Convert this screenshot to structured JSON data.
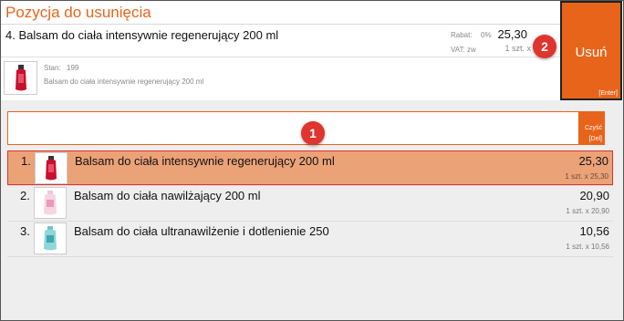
{
  "header": {
    "title": "Pozycja do usunięcia"
  },
  "selected": {
    "name": "4. Balsam do ciała intensywnie regenerujący 200 ml",
    "rabat_label": "Rabat:",
    "rabat_value": "0%",
    "vat_label": "VAT:",
    "vat_value": "zw",
    "price": "25,30",
    "qty": "1 szt. x",
    "stan_label": "Stan:",
    "stan_value": "199",
    "description": "Balsam do ciała intensywnie regenerujący 200 ml",
    "thumb_icon": "lotion-bottle-red-icon"
  },
  "remove_button": {
    "label": "Usuń",
    "shortcut": "[Enter]"
  },
  "search": {
    "value": "",
    "clear_label": "Czyść",
    "clear_shortcut": "[Del]"
  },
  "items": [
    {
      "num": "1.",
      "name": "Balsam do ciała intensywnie regenerujący 200 ml",
      "price": "25,30",
      "qty": "1 szt. x 25,30",
      "selected": true,
      "icon": "lotion-bottle-red-icon"
    },
    {
      "num": "2.",
      "name": "Balsam do ciała nawilżający 200 ml",
      "price": "20,90",
      "qty": "1 szt. x 20,90",
      "selected": false,
      "icon": "lotion-bottle-pink-icon"
    },
    {
      "num": "3.",
      "name": "Balsam do ciała ultranawilżenie i dotlenienie 250",
      "price": "10,56",
      "qty": "1 szt. x 10,56",
      "selected": false,
      "icon": "lotion-bottle-teal-icon"
    }
  ],
  "badges": {
    "one": "1",
    "two": "2"
  },
  "colors": {
    "accent": "#e8641b",
    "selected_row": "#eba277",
    "badge": "#e0342f"
  }
}
